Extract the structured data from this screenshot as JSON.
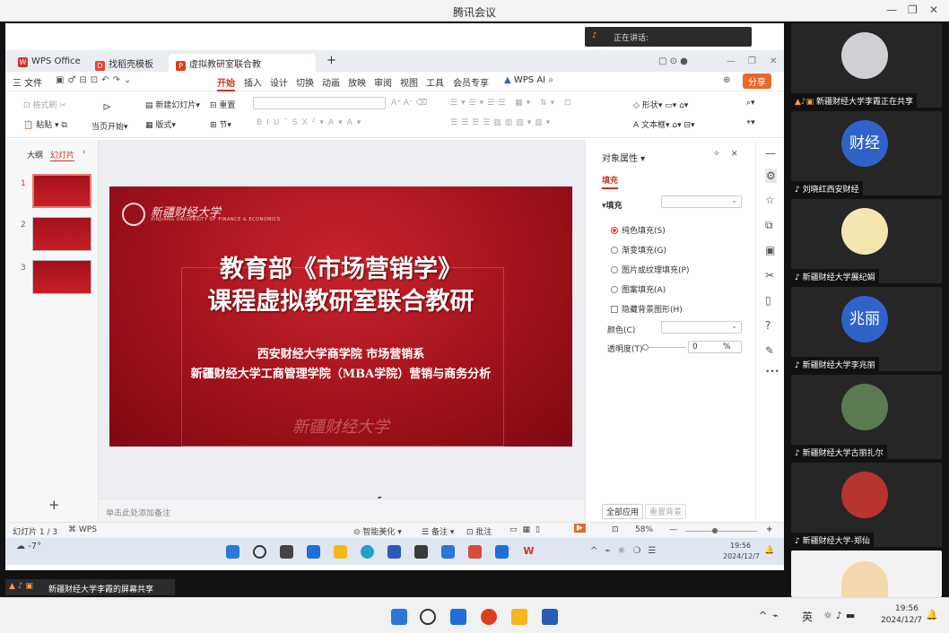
{
  "meeting": {
    "title": "腾讯会议"
  },
  "speaking": {
    "label": "正在讲话:"
  },
  "wps": {
    "tabs": [
      {
        "label": "WPS Office"
      },
      {
        "label": "找稻壳模板"
      },
      {
        "label": "虚拟教研室联合教研.pptx"
      }
    ],
    "menu": {
      "file": "三 文件",
      "items": [
        "开始",
        "插入",
        "设计",
        "切换",
        "动画",
        "放映",
        "审阅",
        "视图",
        "工具",
        "会员专享"
      ],
      "wps_ai": "WPS AI",
      "share": "分享"
    },
    "ribbon": {
      "format_painter": "格式刷",
      "paste": "粘贴",
      "play_from_current": "当页开始",
      "new_slide": "新建幻灯片",
      "layout": "版式",
      "reset": "重置",
      "section": "节",
      "shape": "形状",
      "textbox": "文本框"
    },
    "left_panel": {
      "outline_tab": "大纲",
      "slides_tab": "幻灯片",
      "slide_numbers": [
        "1",
        "2",
        "3"
      ],
      "add": "+"
    },
    "slide": {
      "logo_text": "新疆财经大学",
      "logo_sub": "XINJIANG UNIVERSITY OF FINANCE & ECONOMICS",
      "title_line1": "教育部《市场营销学》",
      "title_line2": "课程虚拟教研室联合教研",
      "subtitle_line1": "西安财经大学商学院 市场营销系",
      "subtitle_line2": "新疆财经大学工商管理学院（MBA学院）营销与商务分析",
      "calligraphy": "新疆财经大学"
    },
    "props": {
      "title": "对象属性",
      "fill_tab": "填充",
      "fill_label": "填充",
      "options": [
        "纯色填充(S)",
        "渐变填充(G)",
        "图片或纹理填充(P)",
        "图案填充(A)"
      ],
      "hide_bg": "隐藏背景图形(H)",
      "color_label": "颜色(C)",
      "transparency_label": "透明度(T)",
      "transparency_value": "0",
      "percent": "%",
      "apply_all": "全部应用",
      "reset_bg": "重置背景"
    },
    "notes_placeholder": "单击此处添加备注",
    "status": {
      "slide_count": "幻灯片 1 / 3",
      "wps": "WPS",
      "beautify": "智能美化",
      "notes": "备注",
      "comments": "批注",
      "zoom": "58%"
    },
    "inner_taskbar": {
      "time": "19:56",
      "date": "2024/12/7",
      "weather": "-7°"
    }
  },
  "sharing_bar": "新疆财经大学李霞的屏幕共享",
  "participants": [
    {
      "name": "新疆财经大学李霞正在共享",
      "avatar_text": ""
    },
    {
      "name": "刘晓红西安财经",
      "avatar_text": "财经"
    },
    {
      "name": "新疆财经大学展纪娟",
      "avatar_text": ""
    },
    {
      "name": "新疆财经大学李兆丽",
      "avatar_text": "兆丽"
    },
    {
      "name": "新疆财经大学古丽扎尔",
      "avatar_text": ""
    },
    {
      "name": "新疆财经大学-郑仙",
      "avatar_text": ""
    }
  ],
  "taskbar": {
    "lang": "英",
    "time": "19:56",
    "date": "2024/12/7"
  },
  "colors": {
    "accent": "#d4321f",
    "slide_red": "#a3121b",
    "avatar_blue": "#2f63c9"
  }
}
